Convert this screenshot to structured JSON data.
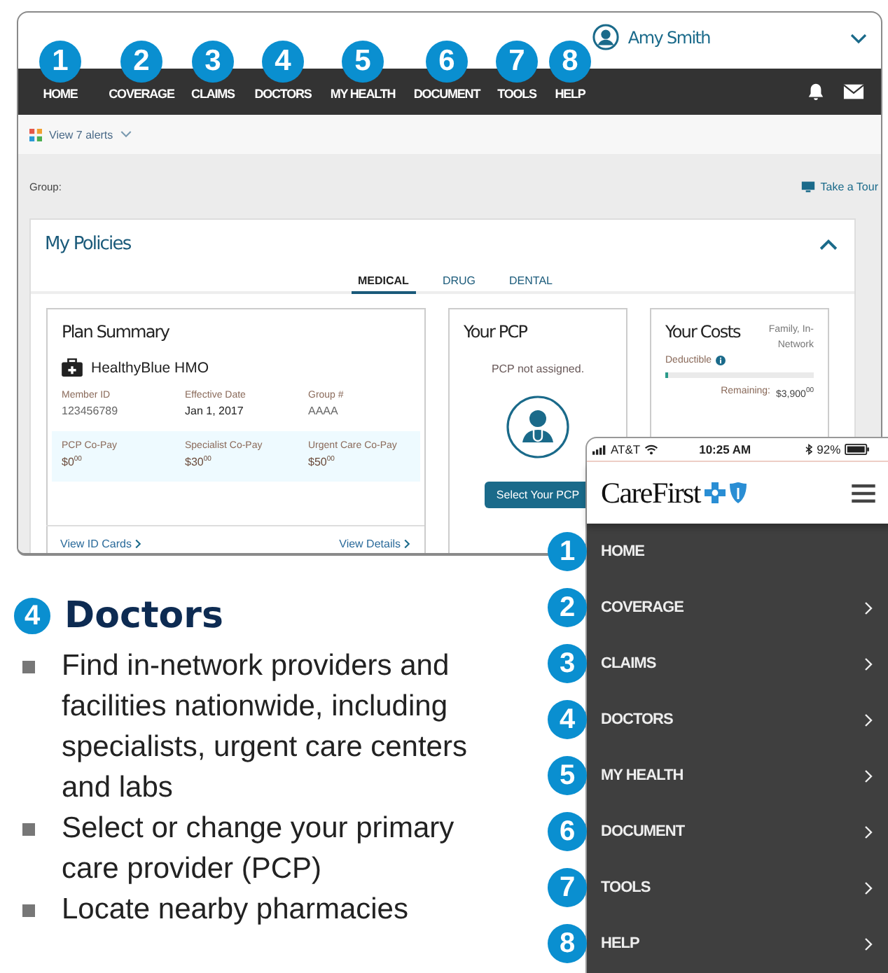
{
  "desktop": {
    "user_name": "Amy Smith",
    "nav": [
      {
        "badge": "1",
        "label": "HOME"
      },
      {
        "badge": "2",
        "label": "COVERAGE"
      },
      {
        "badge": "3",
        "label": "CLAIMS"
      },
      {
        "badge": "4",
        "label": "DOCTORS"
      },
      {
        "badge": "5",
        "label": "MY HEALTH"
      },
      {
        "badge": "6",
        "label": "DOCUMENT"
      },
      {
        "badge": "7",
        "label": "TOOLS"
      },
      {
        "badge": "8",
        "label": "HELP"
      }
    ],
    "alerts": "View 7 alerts",
    "group_label": "Group:",
    "tour": "Take a Tour",
    "policies": {
      "title": "My Policies",
      "tabs": [
        {
          "label": "MEDICAL",
          "selected": true
        },
        {
          "label": "DRUG",
          "selected": false
        },
        {
          "label": "DENTAL",
          "selected": false
        }
      ],
      "plan_summary": {
        "title": "Plan Summary",
        "plan_name": "HealthyBlue HMO",
        "fields": [
          {
            "label": "Member ID",
            "value": "123456789"
          },
          {
            "label": "Effective Date",
            "value": "Jan 1, 2017"
          },
          {
            "label": "Group #",
            "value": "AAAA"
          }
        ],
        "copays": [
          {
            "label": "PCP Co-Pay",
            "value": "$0$^{00}$"
          },
          {
            "label": "Specialist Co-Pay",
            "value": "$30$^{00}$"
          },
          {
            "label": "Urgent Care Co-Pay",
            "value": "$50$^{00}$"
          }
        ],
        "links": [
          "View ID Cards",
          "View Details"
        ]
      },
      "pcp": {
        "title": "Your PCP",
        "status": "PCP not assigned.",
        "button": "Select Your PCP"
      },
      "costs": {
        "title": "Your Costs",
        "scope": "Family, In-Network",
        "deductible_label": "Deductible",
        "level": 0.02,
        "remaining_label": "Remaining:",
        "remaining": "$3,900$^{00}$"
      }
    }
  },
  "phone": {
    "carrier": "AT&T",
    "time": "10:25 AM",
    "battery": "92%",
    "logo": "CareFirst",
    "menu": [
      {
        "badge": "1",
        "label": "HOME",
        "expandable": false
      },
      {
        "badge": "2",
        "label": "COVERAGE",
        "expandable": true
      },
      {
        "badge": "3",
        "label": "CLAIMS",
        "expandable": true
      },
      {
        "badge": "4",
        "label": "DOCTORS",
        "expandable": true
      },
      {
        "badge": "5",
        "label": "MY HEALTH",
        "expandable": true
      },
      {
        "badge": "6",
        "label": "DOCUMENT",
        "expandable": true
      },
      {
        "badge": "7",
        "label": "TOOLS",
        "expandable": true
      },
      {
        "badge": "8",
        "label": "HELP",
        "expandable": true
      }
    ]
  },
  "callout": {
    "badge": "4",
    "title": "Doctors",
    "bullets": [
      "Find in-network providers and facilities nationwide, including specialists, urgent care centers and labs",
      "Select or change your primary care provider (PCP)",
      "Locate nearby pharmacies"
    ]
  }
}
